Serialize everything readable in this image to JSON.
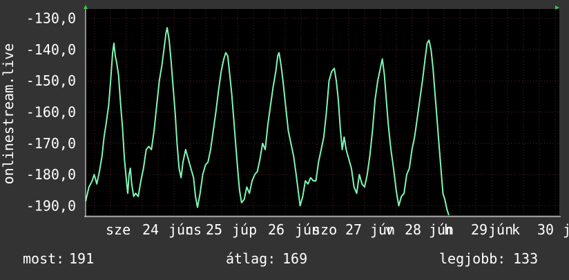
{
  "chart_data": {
    "type": "line",
    "ylabel": "onlinestream.live",
    "ylim": [
      -193,
      -127
    ],
    "y_ticks": [
      "-130,0",
      "-140,0",
      "-150,0",
      "-160,0",
      "-170,0",
      "-180,0",
      "-190,0"
    ],
    "y_tick_values": [
      -130,
      -140,
      -150,
      -160,
      -170,
      -180,
      -190
    ],
    "x_tick_labels": [
      "sze",
      "24",
      "jún",
      "cs",
      "25",
      "júp",
      "26",
      "jún",
      "szo",
      "27",
      "jún",
      "v",
      "28",
      "jún",
      "h",
      "29",
      "jún",
      "k",
      "30",
      "j"
    ],
    "x_domain": [
      0,
      7.2
    ],
    "grid": true,
    "colors": {
      "background": "#333333",
      "plot_bg": "#000000",
      "line": "#7ff7b4",
      "grid": "#5a2a2a",
      "axis": "#ffffff"
    },
    "series": [
      {
        "values": [
          [
            0.0,
            -188.5
          ],
          [
            0.05,
            -184
          ],
          [
            0.1,
            -182
          ],
          [
            0.13,
            -180
          ],
          [
            0.17,
            -183
          ],
          [
            0.21,
            -179
          ],
          [
            0.25,
            -174
          ],
          [
            0.28,
            -168
          ],
          [
            0.31,
            -164
          ],
          [
            0.35,
            -158
          ],
          [
            0.38,
            -150
          ],
          [
            0.41,
            -141
          ],
          [
            0.43,
            -138
          ],
          [
            0.45,
            -142
          ],
          [
            0.47,
            -144
          ],
          [
            0.5,
            -148
          ],
          [
            0.53,
            -157
          ],
          [
            0.56,
            -165
          ],
          [
            0.59,
            -175
          ],
          [
            0.62,
            -182
          ],
          [
            0.64,
            -186
          ],
          [
            0.66,
            -180
          ],
          [
            0.68,
            -178
          ],
          [
            0.7,
            -183
          ],
          [
            0.73,
            -187
          ],
          [
            0.76,
            -186
          ],
          [
            0.8,
            -187
          ],
          [
            0.84,
            -182
          ],
          [
            0.88,
            -178
          ],
          [
            0.92,
            -172
          ],
          [
            0.96,
            -171
          ],
          [
            1.0,
            -172
          ],
          [
            1.04,
            -166
          ],
          [
            1.08,
            -158
          ],
          [
            1.12,
            -150
          ],
          [
            1.16,
            -145
          ],
          [
            1.19,
            -140
          ],
          [
            1.22,
            -135
          ],
          [
            1.24,
            -133
          ],
          [
            1.27,
            -137
          ],
          [
            1.3,
            -144
          ],
          [
            1.33,
            -152
          ],
          [
            1.36,
            -160
          ],
          [
            1.39,
            -170
          ],
          [
            1.42,
            -178
          ],
          [
            1.45,
            -181
          ],
          [
            1.48,
            -176
          ],
          [
            1.52,
            -172
          ],
          [
            1.56,
            -175
          ],
          [
            1.6,
            -178
          ],
          [
            1.64,
            -181
          ],
          [
            1.67,
            -187
          ],
          [
            1.7,
            -190.5
          ],
          [
            1.74,
            -186
          ],
          [
            1.78,
            -180
          ],
          [
            1.82,
            -177
          ],
          [
            1.86,
            -176
          ],
          [
            1.9,
            -172
          ],
          [
            1.94,
            -166
          ],
          [
            1.98,
            -160
          ],
          [
            2.02,
            -153
          ],
          [
            2.06,
            -147
          ],
          [
            2.1,
            -143
          ],
          [
            2.13,
            -141
          ],
          [
            2.16,
            -142
          ],
          [
            2.19,
            -148
          ],
          [
            2.22,
            -154
          ],
          [
            2.25,
            -162
          ],
          [
            2.28,
            -170
          ],
          [
            2.31,
            -178
          ],
          [
            2.34,
            -185
          ],
          [
            2.37,
            -189
          ],
          [
            2.41,
            -188
          ],
          [
            2.45,
            -184
          ],
          [
            2.49,
            -186
          ],
          [
            2.53,
            -182
          ],
          [
            2.57,
            -180
          ],
          [
            2.61,
            -179
          ],
          [
            2.65,
            -175
          ],
          [
            2.69,
            -170
          ],
          [
            2.73,
            -172
          ],
          [
            2.77,
            -164
          ],
          [
            2.81,
            -158
          ],
          [
            2.85,
            -152
          ],
          [
            2.89,
            -147
          ],
          [
            2.92,
            -142
          ],
          [
            2.94,
            -141
          ],
          [
            2.97,
            -145
          ],
          [
            3.0,
            -150
          ],
          [
            3.04,
            -158
          ],
          [
            3.08,
            -166
          ],
          [
            3.12,
            -170
          ],
          [
            3.16,
            -174
          ],
          [
            3.2,
            -180
          ],
          [
            3.23,
            -185
          ],
          [
            3.26,
            -190
          ],
          [
            3.3,
            -187
          ],
          [
            3.34,
            -182
          ],
          [
            3.38,
            -183
          ],
          [
            3.42,
            -181
          ],
          [
            3.46,
            -182
          ],
          [
            3.5,
            -182
          ],
          [
            3.54,
            -176
          ],
          [
            3.58,
            -172
          ],
          [
            3.62,
            -168
          ],
          [
            3.66,
            -160
          ],
          [
            3.7,
            -150
          ],
          [
            3.74,
            -147
          ],
          [
            3.78,
            -146
          ],
          [
            3.81,
            -150
          ],
          [
            3.84,
            -156
          ],
          [
            3.87,
            -165
          ],
          [
            3.9,
            -172
          ],
          [
            3.93,
            -168
          ],
          [
            3.96,
            -172
          ],
          [
            4.0,
            -175
          ],
          [
            4.04,
            -178
          ],
          [
            4.08,
            -184
          ],
          [
            4.12,
            -186
          ],
          [
            4.16,
            -180
          ],
          [
            4.2,
            -183
          ],
          [
            4.24,
            -184
          ],
          [
            4.28,
            -180
          ],
          [
            4.32,
            -174
          ],
          [
            4.36,
            -166
          ],
          [
            4.4,
            -156
          ],
          [
            4.44,
            -150
          ],
          [
            4.48,
            -146
          ],
          [
            4.51,
            -143
          ],
          [
            4.54,
            -148
          ],
          [
            4.57,
            -156
          ],
          [
            4.6,
            -164
          ],
          [
            4.64,
            -172
          ],
          [
            4.68,
            -178
          ],
          [
            4.72,
            -185
          ],
          [
            4.76,
            -190
          ],
          [
            4.8,
            -187
          ],
          [
            4.84,
            -186
          ],
          [
            4.88,
            -180
          ],
          [
            4.92,
            -178
          ],
          [
            4.96,
            -172
          ],
          [
            5.0,
            -168
          ],
          [
            5.04,
            -162
          ],
          [
            5.08,
            -156
          ],
          [
            5.12,
            -150
          ],
          [
            5.16,
            -143
          ],
          [
            5.19,
            -138
          ],
          [
            5.22,
            -137
          ],
          [
            5.25,
            -140
          ],
          [
            5.28,
            -146
          ],
          [
            5.31,
            -154
          ],
          [
            5.34,
            -162
          ],
          [
            5.37,
            -170
          ],
          [
            5.4,
            -178
          ],
          [
            5.43,
            -186
          ],
          [
            5.46,
            -188
          ],
          [
            5.49,
            -191
          ],
          [
            5.52,
            -193
          ]
        ]
      }
    ]
  },
  "stats": [
    {
      "label": "most:",
      "value": "191"
    },
    {
      "label": "átlag:",
      "value": "169"
    },
    {
      "label": "legjobb:",
      "value": "133"
    }
  ]
}
